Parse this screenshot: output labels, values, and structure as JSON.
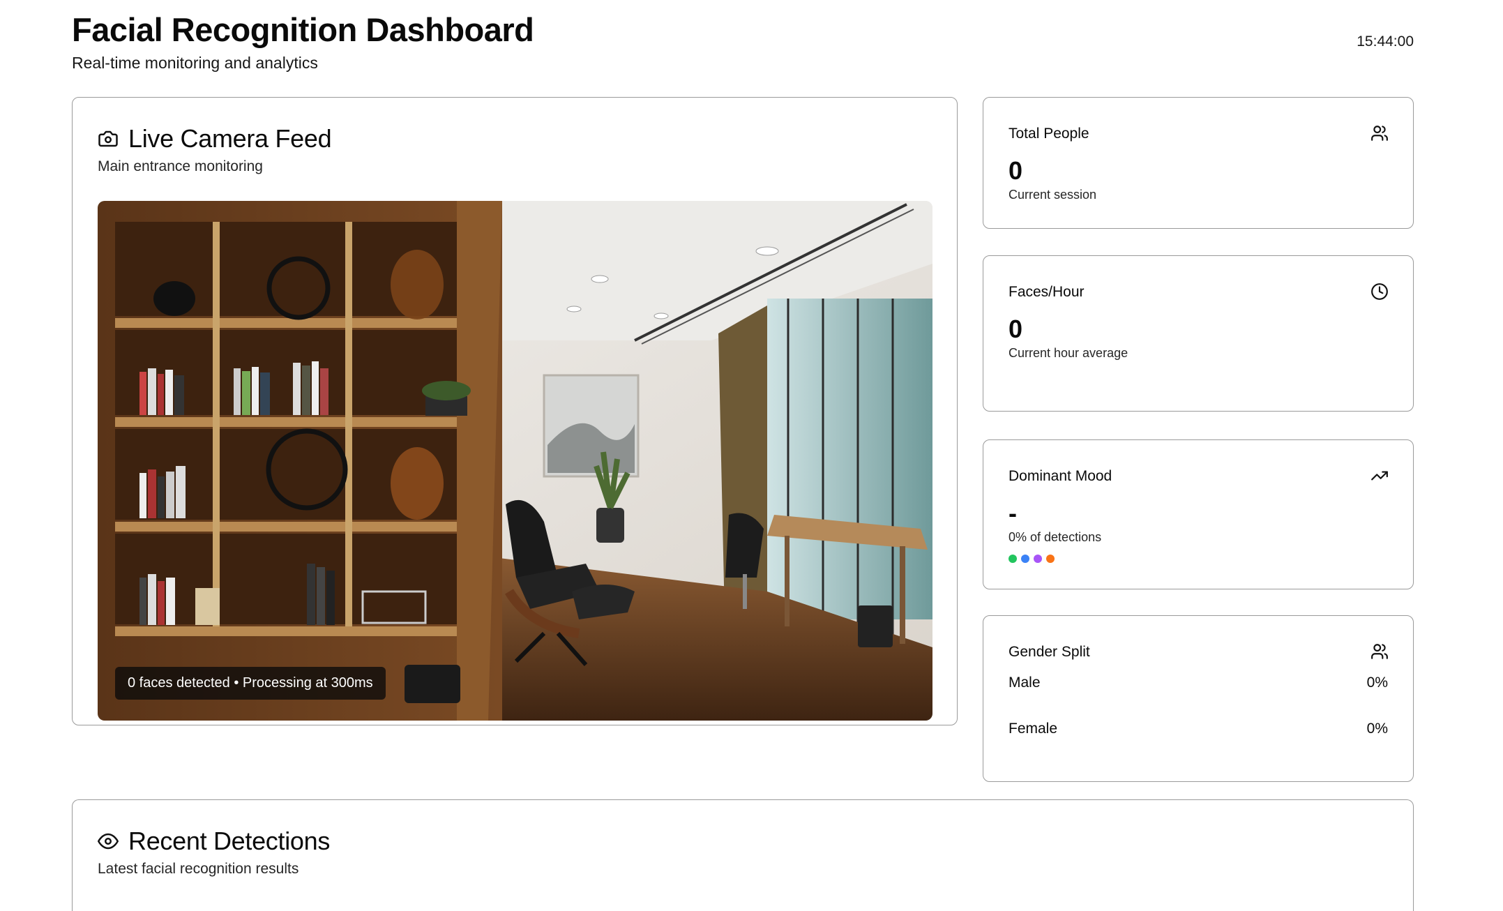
{
  "header": {
    "title": "Facial Recognition Dashboard",
    "subtitle": "Real-time monitoring and analytics",
    "time": "15:44:00"
  },
  "camera": {
    "icon": "camera-icon",
    "title": "Live Camera Feed",
    "description": "Main entrance monitoring",
    "status": "0 faces detected • Processing at 300ms"
  },
  "stats": {
    "total_people": {
      "label": "Total People",
      "icon": "users-icon",
      "value": "0",
      "note": "Current session"
    },
    "faces_per_hour": {
      "label": "Faces/Hour",
      "icon": "clock-icon",
      "value": "0",
      "note": "Current hour average"
    },
    "dominant_mood": {
      "label": "Dominant Mood",
      "icon": "trending-up-icon",
      "value": "-",
      "note": "0% of detections",
      "dot_colors": [
        "#22c55e",
        "#3b82f6",
        "#a855f7",
        "#f97316"
      ]
    },
    "gender_split": {
      "label": "Gender Split",
      "icon": "users-icon",
      "rows": [
        {
          "label": "Male",
          "value": "0%"
        },
        {
          "label": "Female",
          "value": "0%"
        }
      ]
    }
  },
  "recent": {
    "icon": "eye-icon",
    "title": "Recent Detections",
    "description": "Latest facial recognition results"
  }
}
